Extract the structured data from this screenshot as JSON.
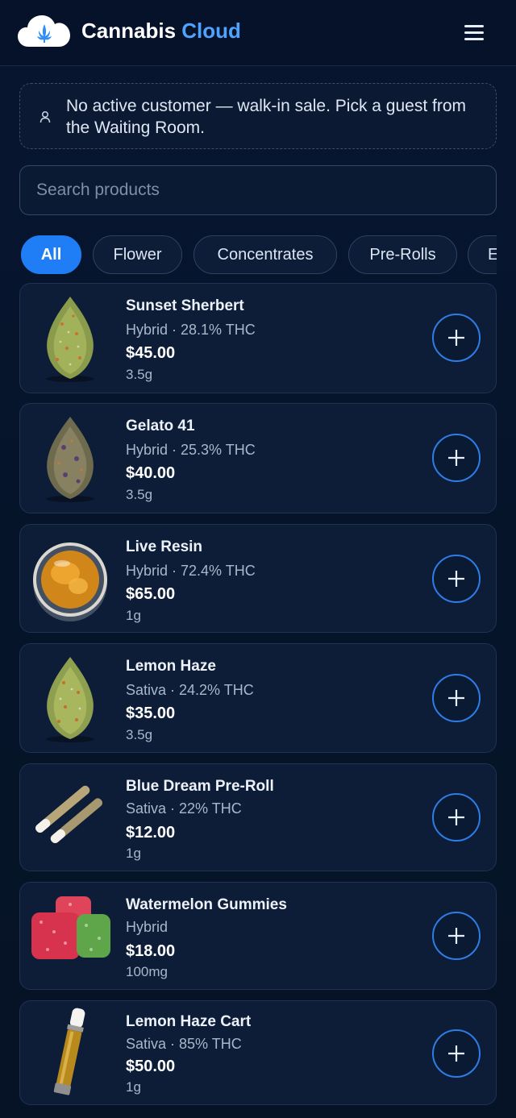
{
  "header": {
    "brand_word1": "Cannabis",
    "brand_word2": "Cloud",
    "logo_icon": "cloud-leaf-icon",
    "menu_icon": "hamburger-icon"
  },
  "notice": {
    "icon": "user-icon",
    "text": "No active customer — walk-in sale. Pick a guest from the Waiting Room."
  },
  "search": {
    "placeholder": "Search products",
    "value": ""
  },
  "categories": [
    {
      "label": "All",
      "active": true
    },
    {
      "label": "Flower",
      "active": false
    },
    {
      "label": "Concentrates",
      "active": false
    },
    {
      "label": "Pre-Rolls",
      "active": false
    },
    {
      "label": "E",
      "active": false
    }
  ],
  "products": [
    {
      "name": "Sunset Sherbert",
      "meta": "Hybrid · 28.1% THC",
      "price": "$45.00",
      "size": "3.5g",
      "image": "flower-bud"
    },
    {
      "name": "Gelato 41",
      "meta": "Hybrid · 25.3% THC",
      "price": "$40.00",
      "size": "3.5g",
      "image": "flower-bud-purple"
    },
    {
      "name": "Live Resin",
      "meta": "Hybrid · 72.4% THC",
      "price": "$65.00",
      "size": "1g",
      "image": "concentrate-jar"
    },
    {
      "name": "Lemon Haze",
      "meta": "Sativa · 24.2% THC",
      "price": "$35.00",
      "size": "3.5g",
      "image": "flower-bud"
    },
    {
      "name": "Blue Dream Pre-Roll",
      "meta": "Sativa · 22% THC",
      "price": "$12.00",
      "size": "1g",
      "image": "pre-rolls"
    },
    {
      "name": "Watermelon Gummies",
      "meta": "Hybrid",
      "price": "$18.00",
      "size": "100mg",
      "image": "gummies"
    },
    {
      "name": "Lemon Haze Cart",
      "meta": "Sativa · 85% THC",
      "price": "$50.00",
      "size": "1g",
      "image": "vape-cartridge"
    }
  ],
  "colors": {
    "accent": "#1f7ef5",
    "brand_highlight": "#4fa3ff",
    "background": "#061429",
    "card": "#0d1d37"
  }
}
